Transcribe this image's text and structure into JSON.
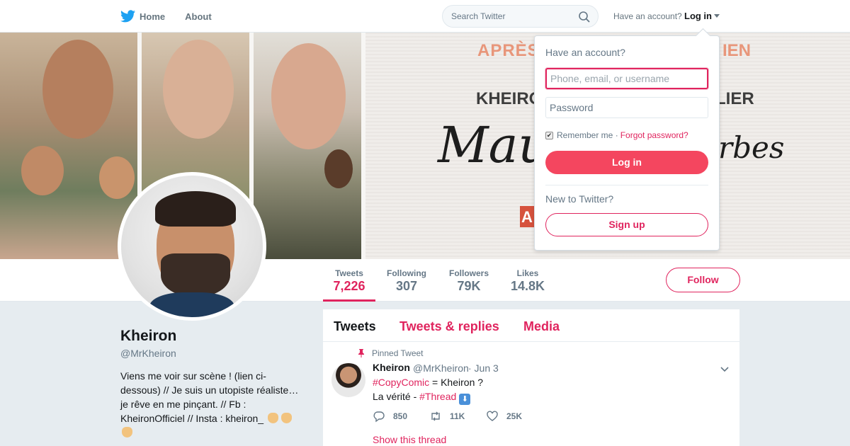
{
  "topnav": {
    "home_label": "Home",
    "about_label": "About",
    "search_placeholder": "Search Twitter",
    "have_account": "Have an account?",
    "login_label": "Log in"
  },
  "banner": {
    "tagline_left": "APRÈS",
    "tagline_right": "IEN",
    "name_left": "KHEIRON",
    "name_right": "LIER",
    "script_left": "Mau",
    "script_right": "rbes",
    "corner_letter": "A"
  },
  "stats": [
    {
      "label": "Tweets",
      "value": "7,226"
    },
    {
      "label": "Following",
      "value": "307"
    },
    {
      "label": "Followers",
      "value": "79K"
    },
    {
      "label": "Likes",
      "value": "14.8K"
    }
  ],
  "follow_label": "Follow",
  "profile": {
    "name": "Kheiron",
    "handle": "@MrKheiron",
    "bio": "Viens me voir sur scène ! (lien ci-dessous) // Je suis un utopiste réaliste… je rêve en me pinçant. // Fb : KheironOfficiel // Insta : kheiron_"
  },
  "timeline": {
    "tabs": [
      "Tweets",
      "Tweets & replies",
      "Media"
    ],
    "tweet": {
      "pinned_label": "Pinned Tweet",
      "author": "Kheiron",
      "handle": "@MrKheiron",
      "date": "· Jun 3",
      "hashtag1": "#CopyComic",
      "line1_rest": " = Kheiron ?",
      "line2_pre": "La vérité - ",
      "hashtag2": "#Thread",
      "replies": "850",
      "retweets": "11K",
      "likes": "25K",
      "show_thread": "Show this thread"
    }
  },
  "login_dropdown": {
    "title": "Have an account?",
    "username_placeholder": "Phone, email, or username",
    "password_placeholder": "Password",
    "remember": "Remember me ·",
    "forgot": "Forgot password?",
    "login_button": "Log in",
    "new_to": "New to Twitter?",
    "signup_button": "Sign up"
  },
  "colors": {
    "accent": "#e0245e",
    "login_button": "#f4465f",
    "brand_blue": "#1da1f2"
  },
  "icons": [
    "twitter-bird-icon",
    "search-icon",
    "caret-down-icon",
    "pin-icon",
    "chevron-down-icon",
    "reply-icon",
    "retweet-icon",
    "heart-icon",
    "point-down-emoji-icon",
    "down-arrow-emoji-icon"
  ]
}
